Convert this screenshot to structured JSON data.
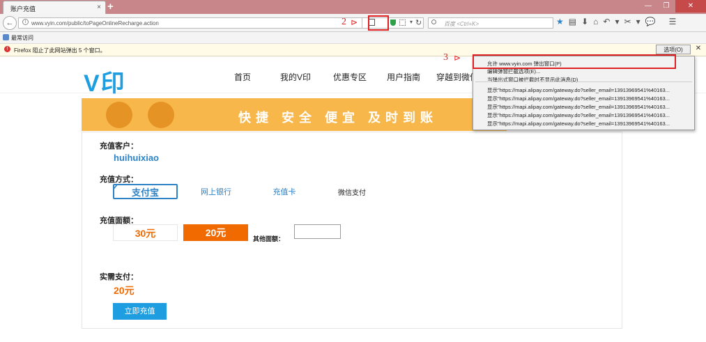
{
  "browser": {
    "tab_title": "账户充值",
    "tab_close": "×",
    "new_tab": "+",
    "window_controls": [
      "—",
      "❐",
      "✕"
    ],
    "url": "www.vyin.com/public/toPageOnlineRecharge.action",
    "search_placeholder": "百度 <Ctrl+K>",
    "bookmarks_label": "最常访问",
    "notification": "Firefox 阻止了此网站弹出 5 个窗口。",
    "options_button": "选项(O)",
    "close_glyph": "✕",
    "toolbar_icons": [
      "star-icon",
      "reading-list-icon",
      "download-icon",
      "home-icon",
      "undo-icon",
      "screenshot-icon",
      "chat-icon",
      "menu-icon"
    ]
  },
  "site": {
    "logo": "V印",
    "nav": [
      "首页",
      "我的V印",
      "优惠专区",
      "用户指南",
      "穿越到微信"
    ],
    "banner_text": "快捷 安全 便宜 及时到账"
  },
  "form": {
    "customer_label": "充值客户：",
    "customer_name": "huihuixiao",
    "method_label": "充值方式：",
    "methods": [
      "支付宝",
      "网上银行",
      "充值卡",
      "微信支付"
    ],
    "amount_label": "充值面额：",
    "amounts": [
      "30元",
      "20元"
    ],
    "other_amount_label": "其他面额：",
    "pay_label": "实需支付：",
    "pay_amount": "20元",
    "submit": "立即充值"
  },
  "popup_menu": {
    "allow": "允许 www.vyin.com 弹出窗口(P)",
    "edit": "编辑弹窗拦截选项(E)...",
    "dont_show": "当弹出式窗口被拦截时不显示此消息(D)",
    "blocked_items": [
      "显示\"https://mapi.alipay.com/gateway.do?seller_email=13913969541%40163...",
      "显示\"https://mapi.alipay.com/gateway.do?seller_email=13913969541%40163...",
      "显示\"https://mapi.alipay.com/gateway.do?seller_email=13913969541%40163...",
      "显示\"https://mapi.alipay.com/gateway.do?seller_email=13913969541%40163...",
      "显示\"https://mapi.alipay.com/gateway.do?seller_email=13913969541%40163..."
    ]
  },
  "annotations": {
    "step2": "2",
    "step3": "3"
  },
  "colors": {
    "accent_blue": "#1e9ee0",
    "accent_orange": "#f06a00",
    "annotation_red": "#e02020"
  }
}
